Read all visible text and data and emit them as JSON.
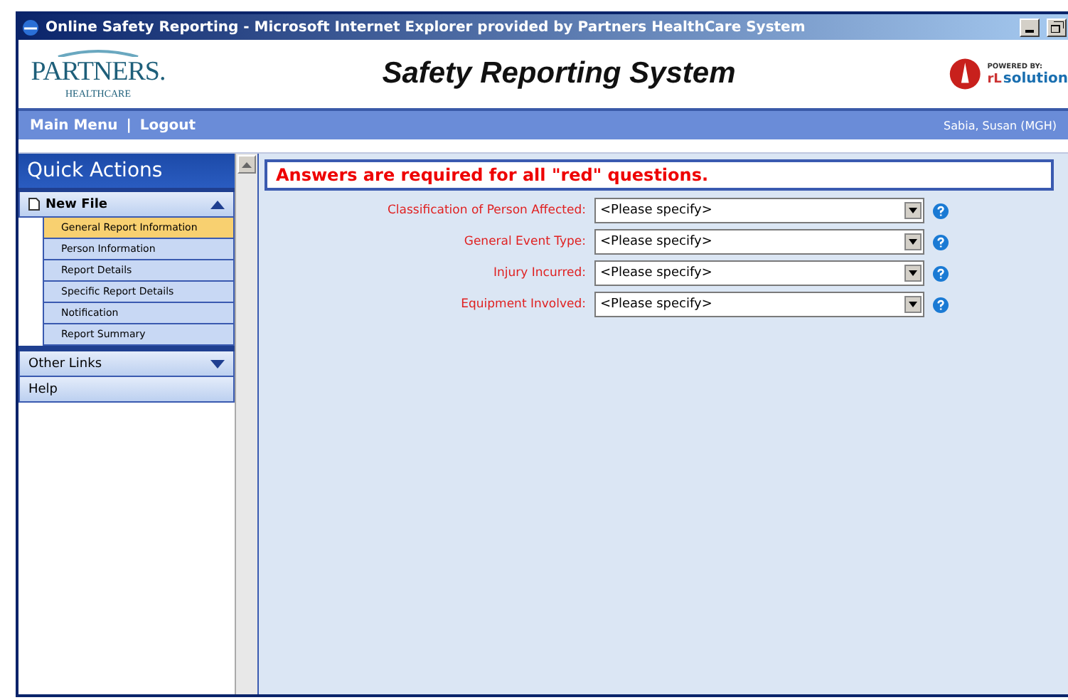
{
  "window": {
    "title": "Online Safety Reporting - Microsoft Internet Explorer provided by Partners HealthCare System"
  },
  "header": {
    "logo_name": "PARTNERS.",
    "logo_sub": "HEALTHCARE",
    "title": "Safety Reporting System",
    "powered_by": "POWERED BY:",
    "vendor_mark": "rL",
    "vendor": "solution"
  },
  "nav": {
    "links": [
      "Main Menu",
      "Logout"
    ],
    "separator": "|",
    "user": "Sabia, Susan (MGH)"
  },
  "sidebar": {
    "title": "Quick Actions",
    "sections": [
      {
        "label": "New File",
        "expanded": true,
        "items": [
          {
            "label": "General Report Information",
            "selected": true
          },
          {
            "label": "Person Information",
            "selected": false
          },
          {
            "label": "Report Details",
            "selected": false
          },
          {
            "label": "Specific Report Details",
            "selected": false
          },
          {
            "label": "Notification",
            "selected": false
          },
          {
            "label": "Report Summary",
            "selected": false
          }
        ]
      },
      {
        "label": "Other Links",
        "expanded": false
      },
      {
        "label": "Help"
      }
    ]
  },
  "notice": "Answers are required for all \"red\" questions.",
  "fields": [
    {
      "label": "Classification of Person Affected:",
      "value": "<Please specify>"
    },
    {
      "label": "General Event Type:",
      "value": "<Please specify>"
    },
    {
      "label": "Injury Incurred:",
      "value": "<Please specify>"
    },
    {
      "label": "Equipment Involved:",
      "value": "<Please specify>"
    }
  ]
}
